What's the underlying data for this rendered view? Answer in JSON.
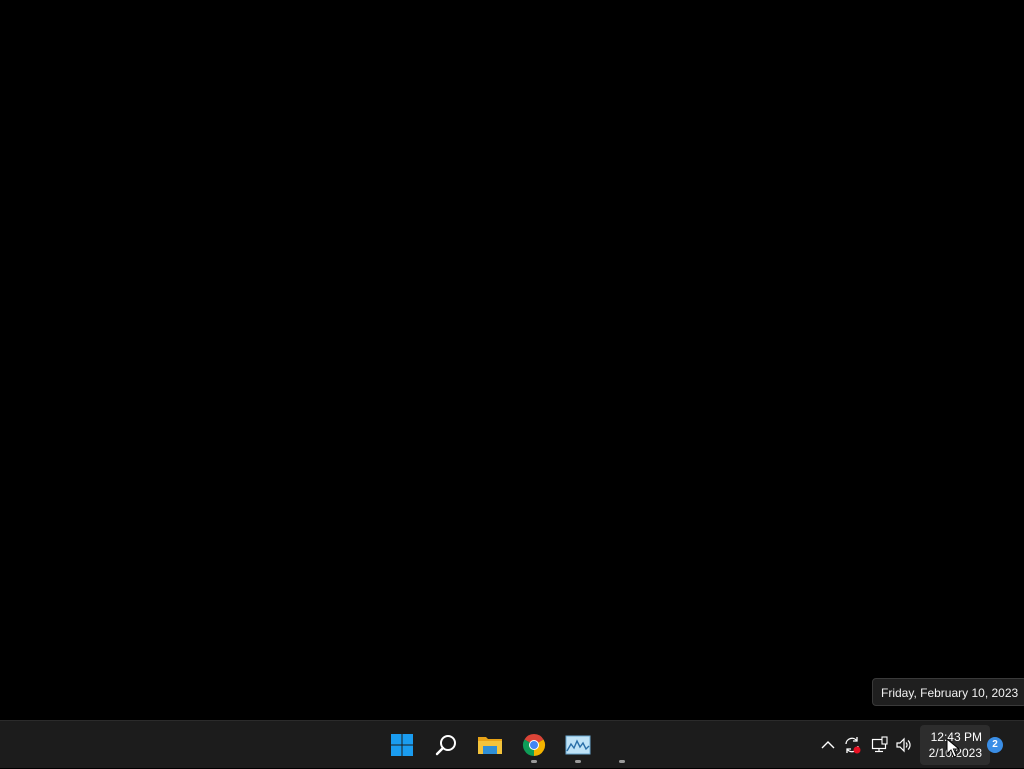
{
  "desktop": {
    "tooltip_text": "Friday, February 10, 2023"
  },
  "taskbar": {
    "pinned": [
      {
        "name": "start",
        "icon": "windows-logo-icon",
        "running": false
      },
      {
        "name": "search",
        "icon": "search-icon",
        "running": false
      },
      {
        "name": "file-explorer",
        "icon": "folder-icon",
        "running": false
      },
      {
        "name": "chrome",
        "icon": "chrome-icon",
        "running": true
      },
      {
        "name": "image-viewer",
        "icon": "image-icon",
        "running": true
      },
      {
        "name": "blank-app",
        "icon": "blank-app-icon",
        "running": true
      }
    ],
    "tray": {
      "icons": [
        "chevron-up-icon",
        "sync-icon",
        "network-icon",
        "volume-icon"
      ],
      "clock_time": "12:43 PM",
      "clock_date": "2/10/2023",
      "notification_count": "2"
    }
  },
  "colors": {
    "taskbar_bg": "#1c1c1c",
    "accent": "#3a8ee6",
    "folder_yellow": "#f3c33b"
  }
}
